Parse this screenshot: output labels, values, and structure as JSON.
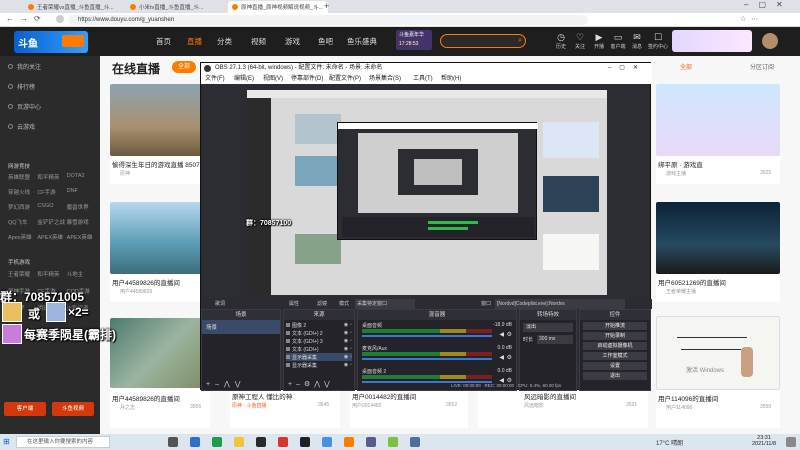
{
  "browser": {
    "tabs": [
      "王者荣耀vs直播_斗鱼直播_斗...",
      "小米tv直播_斗鱼直播_斗...",
      "原神直播_原神视频解说视频_斗..."
    ],
    "url": "https://www.douyu.com/g_yuanshen"
  },
  "site": {
    "logo": "斗鱼",
    "nav": [
      "首页",
      "直播",
      "分类",
      "视频",
      "游戏",
      "鱼吧",
      "鱼乐盛典"
    ],
    "search_badge": "斗鱼嘉年华",
    "search_badge_time": "17:28:53",
    "header_icons": [
      "历史",
      "关注",
      "开播",
      "客户端",
      "消息",
      "签约中心"
    ]
  },
  "sidebar": {
    "items": [
      "我的关注",
      "排行榜",
      "页游中心",
      "云游戏"
    ],
    "section_games": "网游竞技",
    "games": [
      "英雄联盟",
      "和平精英",
      "DOTA2",
      "穿越火线",
      "CF手游",
      "DNF",
      "梦幻西游",
      "CSGO",
      "魔兽世界",
      "QQ飞车",
      "金铲铲之战",
      "暴雪游戏",
      "Apex英雄",
      "APEX英雄",
      "APEX英雄"
    ],
    "section_mobile": "手机游戏",
    "mobile": [
      "王者荣耀",
      "和平精英",
      "斗地主",
      "原神手游",
      "CF手游",
      "COD手游",
      "宝可梦",
      "明日方舟",
      "火影忍者"
    ],
    "bottom_buttons": [
      "客户端",
      "斗鱼视频"
    ]
  },
  "main": {
    "heading": "在线直播",
    "follow_button": "全部",
    "right_label1": "全部",
    "right_label2": "分区订阅",
    "cards": [
      {
        "title": "愉得深生年日的游戏直播 8507...",
        "meta": "原神"
      },
      {
        "title": "用户44589826的直播间",
        "meta": "用户44589826"
      },
      {
        "title": "用户44589826的直播间",
        "meta": "月之志"
      },
      {
        "title": "原神工程人 懂比的神",
        "meta": "原神 · 斗鱼直播",
        "count": "3545"
      },
      {
        "title": "用户0014482的直播间",
        "meta": "用户0014482",
        "count": "3552"
      },
      {
        "title": "风远暗影的直播间",
        "meta": "风远暗影",
        "count": "3521"
      },
      {
        "title": "绑平原 · 游戏直",
        "meta": "游戏主播",
        "count": "3525"
      },
      {
        "title": "用户60521269的直播间",
        "meta": "王者荣耀主播"
      },
      {
        "title": "用户114096的直播间",
        "meta": "用户114096",
        "count": "3550"
      }
    ],
    "card_count": "3556"
  },
  "obs": {
    "title": "OBS 27.1.3 (64-bit, windows) - 配置文件: 未命名 - 场景: 未命名",
    "menu": [
      "文件(F)",
      "编辑(E)",
      "视图(V)",
      "停靠部件(D)",
      "配置文件(P)",
      "场景集合(S)",
      "工具(T)",
      "帮助(H)"
    ],
    "source_bar": [
      "歌词",
      "属性",
      "滤镜",
      "模式",
      "采集特定窗口",
      "窗口",
      "[Nordvd]Codeplist.exe]:Nordvs"
    ],
    "scenes_header": "场景",
    "scene": "场景",
    "sources_header": "来源",
    "sources": [
      "图像 2",
      "文本 (GDI+) 2",
      "文本 (GDI+) 3",
      "文本 (GDI+)",
      "显示器采集",
      "显示器采集"
    ],
    "mixer_header": "混音器",
    "mixer": [
      {
        "name": "桌面音频",
        "db": "-18.9 dB"
      },
      {
        "name": "麦克风/Aux",
        "db": "0.0 dB"
      },
      {
        "name": "桌面音频 2",
        "db": "0.0 dB"
      }
    ],
    "transition_header": "转场特效",
    "transition": "淡出",
    "duration_label": "时长",
    "duration": "300 ms",
    "controls_header": "控件",
    "controls": [
      "开始推流",
      "开始录制",
      "启动虚拟摄像机",
      "工作室模式",
      "设置",
      "退出"
    ],
    "status": "CPU: 5.4%, 60.00 fps",
    "live": "LIVE: 00:00:00",
    "rec": "REC: 00:00:00"
  },
  "overlay": {
    "group": "群：708571005",
    "group_small": "群：70857100",
    "or": "或",
    "x2": "×2=",
    "rank": "每赛季陨星(霸排)"
  },
  "taskbar": {
    "search": "在这里输入你要搜索的内容",
    "weather": "17°C 晴朗",
    "time": "23:31",
    "date": "2021/11/8",
    "watermark": "激活 Windows"
  },
  "colors": {
    "accent": "#ff7a00",
    "obs_bg": "#2c2c33",
    "taskbar": "#dbe6ef"
  }
}
